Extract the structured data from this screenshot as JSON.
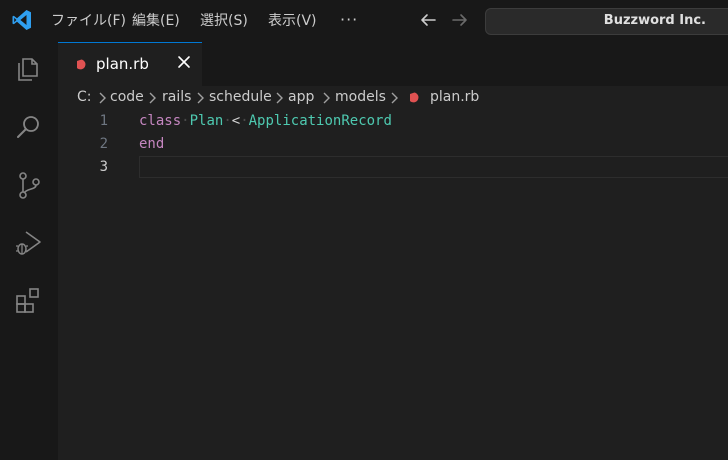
{
  "menu": {
    "file": "ファイル(F)",
    "edit": "編集(E)",
    "selection": "選択(S)",
    "view": "表示(V)",
    "more": "···"
  },
  "search": {
    "text": "Buzzword Inc."
  },
  "colors": {
    "accent": "#0078d4",
    "ruby": "#e05252",
    "keyword": "#c586c0",
    "class": "#4ec9b0"
  },
  "activity": [
    "files-icon",
    "search-icon",
    "source-control-icon",
    "run-debug-icon",
    "extensions-icon"
  ],
  "tab": {
    "label": "plan.rb"
  },
  "breadcrumb": {
    "items": [
      "C:",
      "code",
      "rails",
      "schedule",
      "app",
      "models",
      "plan.rb"
    ]
  },
  "editor": {
    "lines": [
      {
        "num": "1",
        "tokens": {
          "kw": "class",
          "name": "Plan",
          "op": "<",
          "parent": "ApplicationRecord"
        }
      },
      {
        "num": "2",
        "text": "end"
      },
      {
        "num": "3",
        "text": ""
      }
    ]
  }
}
